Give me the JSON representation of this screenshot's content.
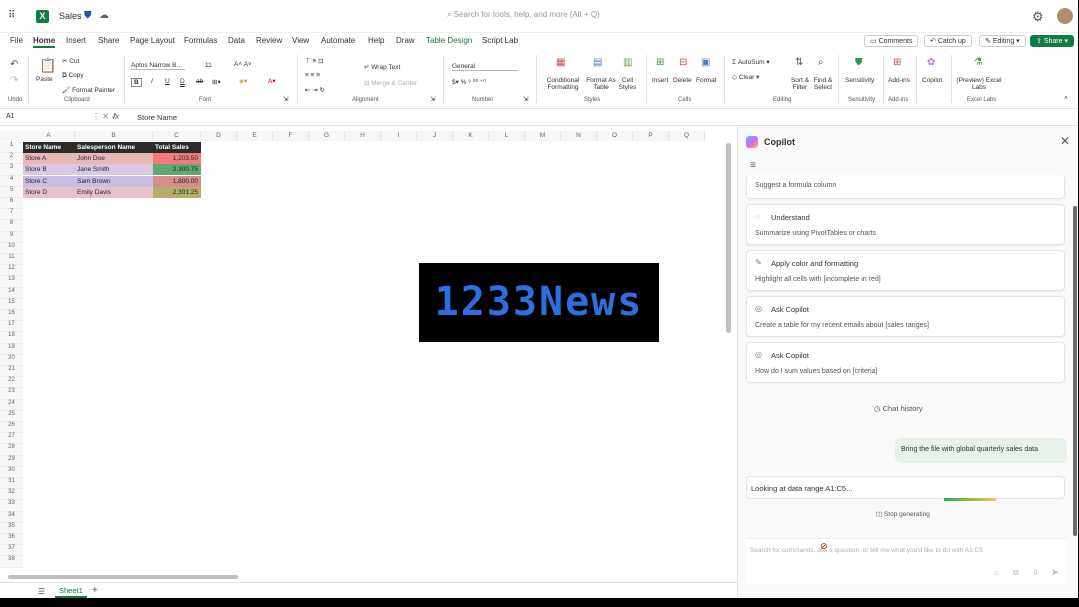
{
  "titlebar": {
    "file_name": "Sales",
    "search_placeholder": "Search for tools, help, and more (Alt + Q)"
  },
  "tabs": [
    "File",
    "Home",
    "Insert",
    "Share",
    "Page Layout",
    "Formulas",
    "Data",
    "Review",
    "View",
    "Automate",
    "Help",
    "Draw",
    "Table Design",
    "Script Lab"
  ],
  "tab_buttons": {
    "comments": "Comments",
    "catchup": "Catch up",
    "editing": "Editing",
    "share": "Share"
  },
  "ribbon": {
    "undo_group": "Undo",
    "clipboard": {
      "paste": "Paste",
      "cut": "Cut",
      "copy": "Copy",
      "format_painter": "Format Painter",
      "label": "Clipboard"
    },
    "font": {
      "family": "Aptos Narrow B...",
      "size": "11",
      "label": "Font"
    },
    "alignment": {
      "wrap": "Wrap Text",
      "merge": "Merge & Center",
      "label": "Alignment"
    },
    "number": {
      "format": "General",
      "label": "Number"
    },
    "styles": {
      "conditional": "Conditional Formatting",
      "format_table": "Format As Table",
      "cell_styles": "Cell Styles",
      "label": "Styles"
    },
    "cells": {
      "insert": "Insert",
      "delete": "Delete",
      "format": "Format",
      "label": "Cells"
    },
    "editing": {
      "autosum": "AutoSum",
      "clear": "Clear",
      "sort": "Sort & Filter",
      "find": "Find & Select",
      "label": "Editing"
    },
    "sensitivity": {
      "btn": "Sensitivity",
      "label": "Sensitivity"
    },
    "addins": {
      "btn": "Add-ins",
      "label": "Add-ins"
    },
    "copilot": "Copilot",
    "excel_labs": {
      "btn": "(Preview) Excel Labs",
      "label": "Excel Labs"
    }
  },
  "formula_bar": {
    "name_box": "A1",
    "fx": "fx",
    "value": "Store Name"
  },
  "columns": [
    "A",
    "B",
    "C",
    "D",
    "E",
    "F",
    "G",
    "H",
    "I",
    "J",
    "K",
    "L",
    "M",
    "N",
    "O",
    "P",
    "Q"
  ],
  "rows": [
    "1",
    "2",
    "3",
    "4",
    "5",
    "6",
    "7",
    "8",
    "9",
    "10",
    "11",
    "12",
    "13",
    "14",
    "15",
    "16",
    "17",
    "18",
    "19",
    "20",
    "21",
    "22",
    "23",
    "24",
    "25",
    "26",
    "27",
    "28",
    "29",
    "30",
    "31",
    "32",
    "33",
    "34",
    "35",
    "36",
    "37",
    "38"
  ],
  "table": {
    "headers": [
      "Store Name",
      "Salesperson Name",
      "Total Sales"
    ],
    "rows": [
      [
        "Store A",
        "John Doe",
        "1,203.50"
      ],
      [
        "Store B",
        "Jane Smith",
        "2,300.75"
      ],
      [
        "Store C",
        "Sam Brown",
        "1,800.00"
      ],
      [
        "Store D",
        "Emily Davis",
        "2,301.25"
      ]
    ],
    "row_colors": [
      "#e8b7b7",
      "#d9c9e0",
      "#c9bde0",
      "#e6c2cc"
    ],
    "sales_colors": [
      "#f27a7a",
      "#5fa86f",
      "#d98c8c",
      "#b5ad6a"
    ]
  },
  "sheet_tab": "Sheet1",
  "watermark": "1233News",
  "copilot": {
    "title": "Copilot",
    "suggest": "Suggest a formula column",
    "cards": [
      {
        "title": "Understand",
        "desc": "Summarize using PivotTables or charts",
        "icon": "lightbulb-icon"
      },
      {
        "title": "Apply color and formatting",
        "desc": "Highlight all cells with [incomplete in red]",
        "icon": "pencil-icon"
      },
      {
        "title": "Ask Copilot",
        "desc": "Create a table for my recent emails about [sales ranges]",
        "icon": "chat-icon"
      },
      {
        "title": "Ask Copilot",
        "desc": "How do I sum values based on [criteria]",
        "icon": "chat-icon"
      }
    ],
    "chat_history": "Chat history",
    "user_message": "Bring the file with global quarterly sales data",
    "bot_message": "Looking at data range A1:C5...",
    "stop": "Stop generating",
    "input_placeholder": "Search for commands, ask a question, or tell me what you'd like to do with A1:C5"
  }
}
